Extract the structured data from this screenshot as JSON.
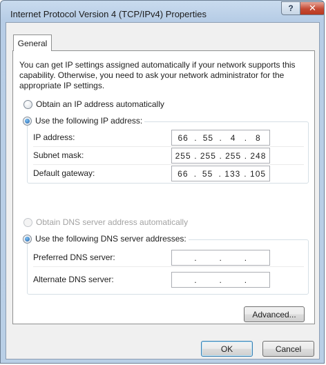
{
  "window": {
    "title": "Internet Protocol Version 4 (TCP/IPv4) Properties",
    "help_label": "?",
    "close_label": "✕"
  },
  "tabs": [
    {
      "label": "General",
      "selected": true
    }
  ],
  "general": {
    "description": "You can get IP settings assigned automatically if your network supports this capability. Otherwise, you need to ask your network administrator for the appropriate IP settings.",
    "ip_auto_label": "Obtain an IP address automatically",
    "ip_auto_checked": false,
    "ip_manual_label": "Use the following IP address:",
    "ip_manual_checked": true,
    "ip_fields": [
      {
        "label": "IP address:",
        "octets": [
          "66",
          "55",
          "4",
          "8"
        ]
      },
      {
        "label": "Subnet mask:",
        "octets": [
          "255",
          "255",
          "255",
          "248"
        ]
      },
      {
        "label": "Default gateway:",
        "octets": [
          "66",
          "55",
          "133",
          "105"
        ]
      }
    ],
    "dns_auto_label": "Obtain DNS server address automatically",
    "dns_auto_enabled": false,
    "dns_manual_label": "Use the following DNS server addresses:",
    "dns_manual_checked": true,
    "dns_fields": [
      {
        "label": "Preferred DNS server:",
        "octets": [
          "",
          "",
          "",
          ""
        ]
      },
      {
        "label": "Alternate DNS server:",
        "octets": [
          "",
          "",
          "",
          ""
        ]
      }
    ],
    "advanced_label": "Advanced..."
  },
  "buttons": {
    "ok_label": "OK",
    "cancel_label": "Cancel"
  }
}
